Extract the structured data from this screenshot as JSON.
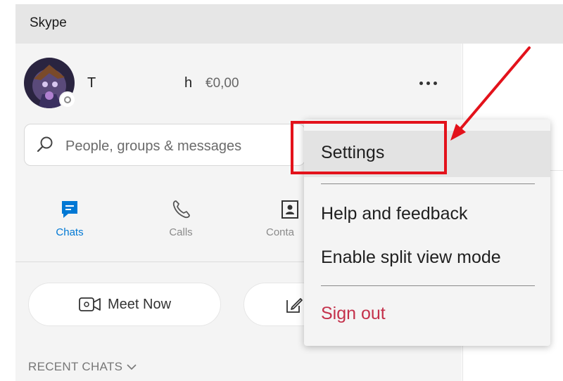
{
  "window": {
    "title": "Skype"
  },
  "profile": {
    "name_initial": "T",
    "name_last": "h",
    "credit": "€0,00"
  },
  "search": {
    "placeholder": "People, groups & messages",
    "icon": "search-icon"
  },
  "nav": {
    "chats": "Chats",
    "calls": "Calls",
    "contacts": "Conta"
  },
  "actions": {
    "meet_now": "Meet Now"
  },
  "recent_chats": {
    "label": "RECENT CHATS"
  },
  "menu": {
    "items": [
      {
        "label": "Settings"
      },
      {
        "label": "Help and feedback"
      },
      {
        "label": "Enable split view mode"
      },
      {
        "label": "Sign out"
      }
    ]
  },
  "colors": {
    "accent": "#0078d4",
    "sign_out": "#c4314b",
    "annotation": "#e3121b"
  }
}
